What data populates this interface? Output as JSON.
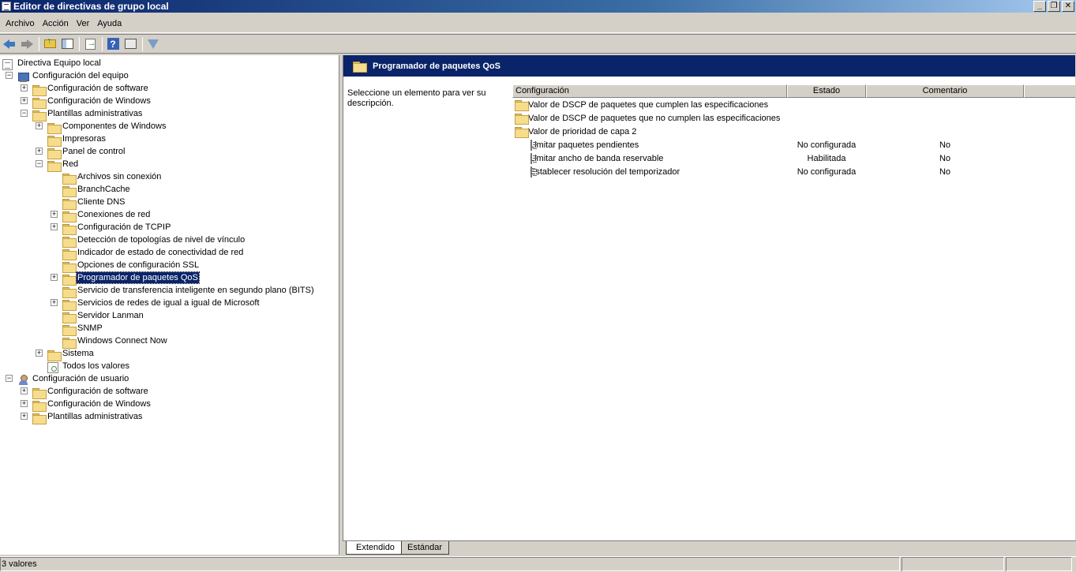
{
  "window": {
    "title": "Editor de directivas de grupo local",
    "buttons": {
      "minimize": "_",
      "maximize": "❐",
      "close": "✕"
    }
  },
  "menu": [
    "Archivo",
    "Acción",
    "Ver",
    "Ayuda"
  ],
  "toolbar": {
    "icons": [
      "back-icon",
      "forward-icon",
      "up-folder-icon",
      "show-hide-tree-icon",
      "export-list-icon",
      "help-icon",
      "properties-icon",
      "filter-icon"
    ]
  },
  "tree": [
    {
      "label": "Directiva Equipo local",
      "level": 0,
      "icon": "doc",
      "expander": ""
    },
    {
      "label": "Configuración del equipo",
      "level": 1,
      "icon": "computer",
      "expander": "−"
    },
    {
      "label": "Configuración de software",
      "level": 2,
      "icon": "folder",
      "expander": "+"
    },
    {
      "label": "Configuración de Windows",
      "level": 2,
      "icon": "folder",
      "expander": "+"
    },
    {
      "label": "Plantillas administrativas",
      "level": 2,
      "icon": "folder",
      "expander": "−"
    },
    {
      "label": "Componentes de Windows",
      "level": 3,
      "icon": "folder",
      "expander": "+"
    },
    {
      "label": "Impresoras",
      "level": 3,
      "icon": "folder",
      "expander": ""
    },
    {
      "label": "Panel de control",
      "level": 3,
      "icon": "folder",
      "expander": "+"
    },
    {
      "label": "Red",
      "level": 3,
      "icon": "folder",
      "expander": "−"
    },
    {
      "label": "Archivos sin conexión",
      "level": 4,
      "icon": "folder",
      "expander": ""
    },
    {
      "label": "BranchCache",
      "level": 4,
      "icon": "folder",
      "expander": ""
    },
    {
      "label": "Cliente DNS",
      "level": 4,
      "icon": "folder",
      "expander": ""
    },
    {
      "label": "Conexiones de red",
      "level": 4,
      "icon": "folder",
      "expander": "+"
    },
    {
      "label": "Configuración de TCPIP",
      "level": 4,
      "icon": "folder",
      "expander": "+"
    },
    {
      "label": "Detección de topologías de nivel de vínculo",
      "level": 4,
      "icon": "folder",
      "expander": ""
    },
    {
      "label": "Indicador de estado de conectividad de red",
      "level": 4,
      "icon": "folder",
      "expander": ""
    },
    {
      "label": "Opciones de configuración SSL",
      "level": 4,
      "icon": "folder",
      "expander": ""
    },
    {
      "label": "Programador de paquetes QoS",
      "level": 4,
      "icon": "folder",
      "expander": "+",
      "selected": true
    },
    {
      "label": "Servicio de transferencia inteligente en segundo plano (BITS)",
      "level": 4,
      "icon": "folder",
      "expander": ""
    },
    {
      "label": "Servicios de redes de igual a igual de Microsoft",
      "level": 4,
      "icon": "folder",
      "expander": "+"
    },
    {
      "label": "Servidor Lanman",
      "level": 4,
      "icon": "folder",
      "expander": ""
    },
    {
      "label": "SNMP",
      "level": 4,
      "icon": "folder",
      "expander": ""
    },
    {
      "label": "Windows Connect Now",
      "level": 4,
      "icon": "folder",
      "expander": ""
    },
    {
      "label": "Sistema",
      "level": 3,
      "icon": "folder",
      "expander": "+"
    },
    {
      "label": "Todos los valores",
      "level": 3,
      "icon": "settings",
      "expander": ""
    },
    {
      "label": "Configuración de usuario",
      "level": 1,
      "icon": "user",
      "expander": "−"
    },
    {
      "label": "Configuración de software",
      "level": 2,
      "icon": "folder",
      "expander": "+"
    },
    {
      "label": "Configuración de Windows",
      "level": 2,
      "icon": "folder",
      "expander": "+"
    },
    {
      "label": "Plantillas administrativas",
      "level": 2,
      "icon": "folder",
      "expander": "+"
    }
  ],
  "details": {
    "header_title": "Programador de paquetes QoS",
    "description": "Seleccione un elemento para ver su descripción.",
    "columns": [
      "Configuración",
      "Estado",
      "Comentario"
    ],
    "rows": [
      {
        "name": "Valor de DSCP de paquetes que cumplen las especificaciones",
        "estado": "",
        "comentario": "",
        "icon": "folder"
      },
      {
        "name": "Valor de DSCP de paquetes que no cumplen las especificaciones",
        "estado": "",
        "comentario": "",
        "icon": "folder"
      },
      {
        "name": "Valor de prioridad de capa 2",
        "estado": "",
        "comentario": "",
        "icon": "folder"
      },
      {
        "name": "Limitar paquetes pendientes",
        "estado": "No configurada",
        "comentario": "No",
        "icon": "setting"
      },
      {
        "name": "Limitar ancho de banda reservable",
        "estado": "Habilitada",
        "comentario": "No",
        "icon": "setting"
      },
      {
        "name": "Establecer resolución del temporizador",
        "estado": "No configurada",
        "comentario": "No",
        "icon": "setting"
      }
    ]
  },
  "tabs": [
    "Extendido",
    "Estándar"
  ],
  "status": {
    "text": "3 valores"
  }
}
